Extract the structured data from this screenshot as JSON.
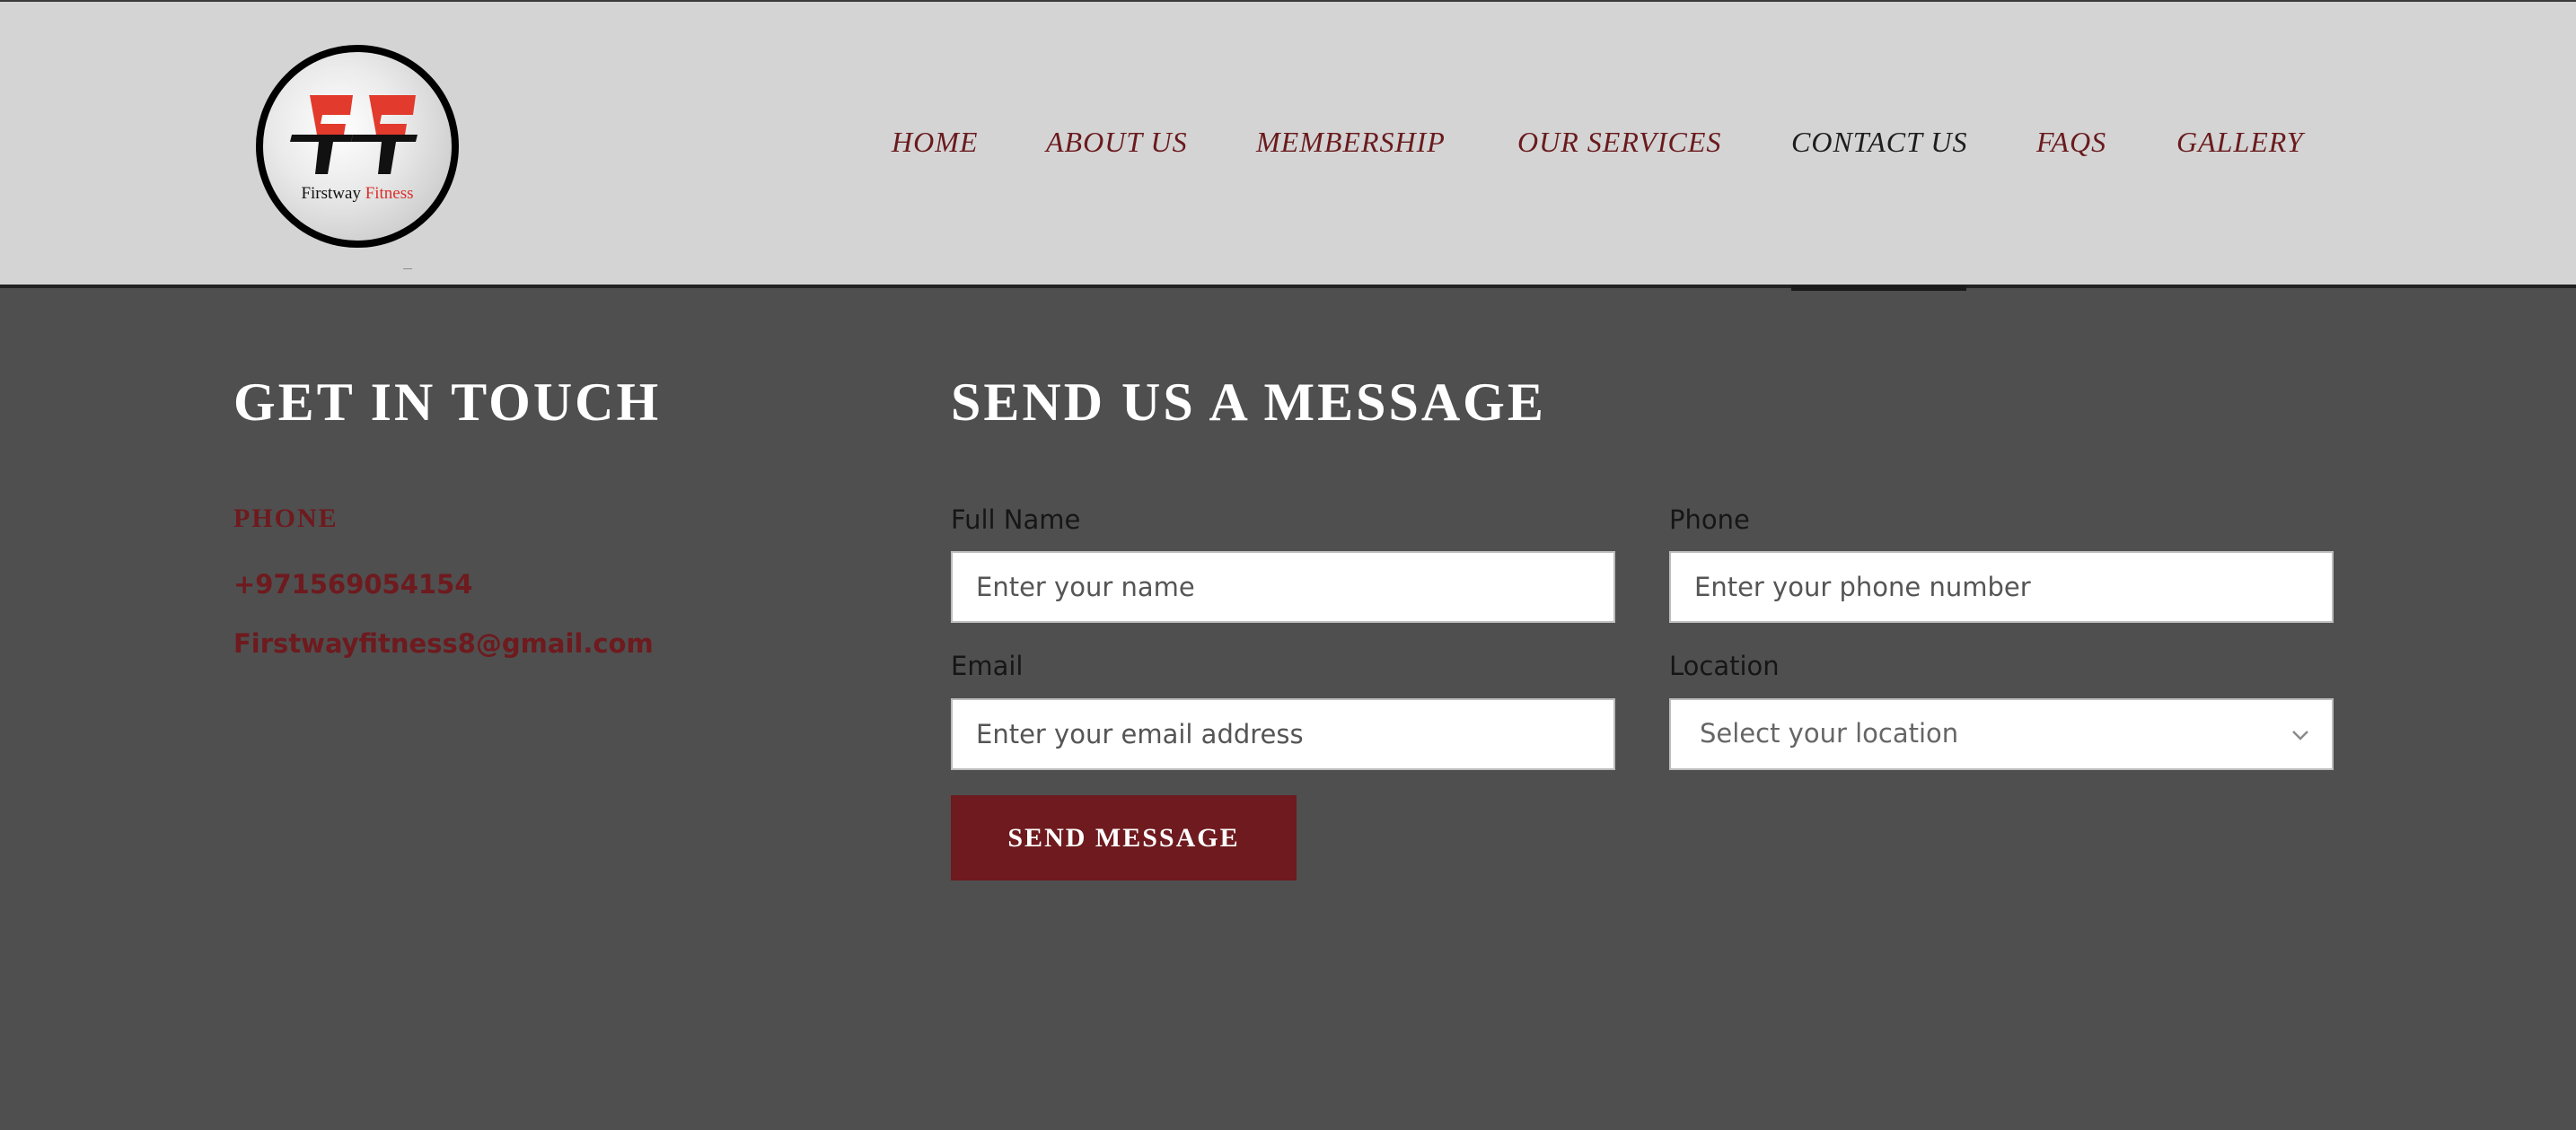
{
  "logo": {
    "monogram": "FF",
    "name_first": "Firstway",
    "name_second": "Fitness"
  },
  "nav": {
    "items": [
      "HOME",
      "ABOUT US",
      "MEMBERSHIP",
      "OUR SERVICES",
      "CONTACT US",
      "FAQS",
      "GALLERY"
    ],
    "active": "CONTACT US"
  },
  "contact": {
    "heading": "GET IN TOUCH",
    "phone_label": "PHONE",
    "phone": "+971569054154",
    "email": "Firstwayfitness8@gmail.com"
  },
  "form": {
    "heading": "SEND US A MESSAGE",
    "full_name": {
      "label": "Full Name",
      "placeholder": "Enter your name"
    },
    "phone": {
      "label": "Phone",
      "placeholder": "Enter your phone number"
    },
    "email": {
      "label": "Email",
      "placeholder": "Enter your email address"
    },
    "location": {
      "label": "Location",
      "selected": "Select your location"
    },
    "submit_label": "SEND MESSAGE"
  },
  "colors": {
    "header_bg": "#d4d4d4",
    "page_bg": "#4f4f4f",
    "accent": "#6e1a1e",
    "logo_red": "#e23a2c"
  },
  "icons": {
    "location_select": "chevron-down-icon"
  }
}
